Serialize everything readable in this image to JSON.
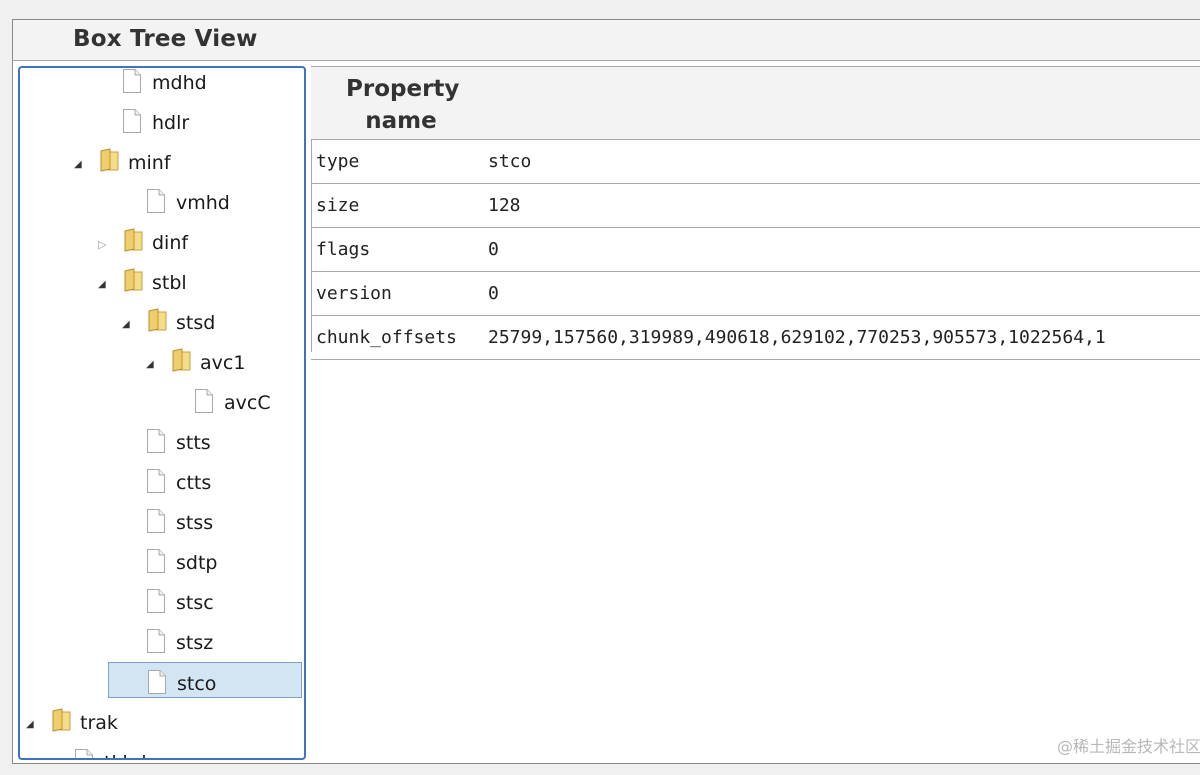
{
  "window": {
    "title": "Box Tree View"
  },
  "tree": {
    "items": [
      {
        "label": "mdhd",
        "kind": "file",
        "expander": "none"
      },
      {
        "label": "hdlr",
        "kind": "file",
        "expander": "none"
      },
      {
        "label": "minf",
        "kind": "folder",
        "expander": "expanded"
      },
      {
        "label": "vmhd",
        "kind": "file",
        "expander": "none"
      },
      {
        "label": "dinf",
        "kind": "folder",
        "expander": "collapsed"
      },
      {
        "label": "stbl",
        "kind": "folder",
        "expander": "expanded"
      },
      {
        "label": "stsd",
        "kind": "folder",
        "expander": "expanded"
      },
      {
        "label": "avc1",
        "kind": "folder",
        "expander": "expanded"
      },
      {
        "label": "avcC",
        "kind": "file",
        "expander": "none"
      },
      {
        "label": "stts",
        "kind": "file",
        "expander": "none"
      },
      {
        "label": "ctts",
        "kind": "file",
        "expander": "none"
      },
      {
        "label": "stss",
        "kind": "file",
        "expander": "none"
      },
      {
        "label": "sdtp",
        "kind": "file",
        "expander": "none"
      },
      {
        "label": "stsc",
        "kind": "file",
        "expander": "none"
      },
      {
        "label": "stsz",
        "kind": "file",
        "expander": "none"
      },
      {
        "label": "stco",
        "kind": "file",
        "expander": "none",
        "selected": true
      },
      {
        "label": "trak",
        "kind": "folder",
        "expander": "expanded"
      },
      {
        "label": "tkhd",
        "kind": "file",
        "expander": "none"
      }
    ]
  },
  "properties": {
    "header": "Property name",
    "rows": [
      {
        "name": "type",
        "value": "stco"
      },
      {
        "name": "size",
        "value": "128"
      },
      {
        "name": "flags",
        "value": "0"
      },
      {
        "name": "version",
        "value": "0"
      },
      {
        "name": "chunk_offsets",
        "value": "25799,157560,319989,490618,629102,770253,905573,1022564,1"
      }
    ]
  },
  "watermark": "@稀土掘金技术社区",
  "colors": {
    "selection_bg": "#d3e5f3",
    "panel_border": "#3d73c0",
    "folder_icon": "#e8c86a",
    "header_bg": "#f3f3f3"
  }
}
